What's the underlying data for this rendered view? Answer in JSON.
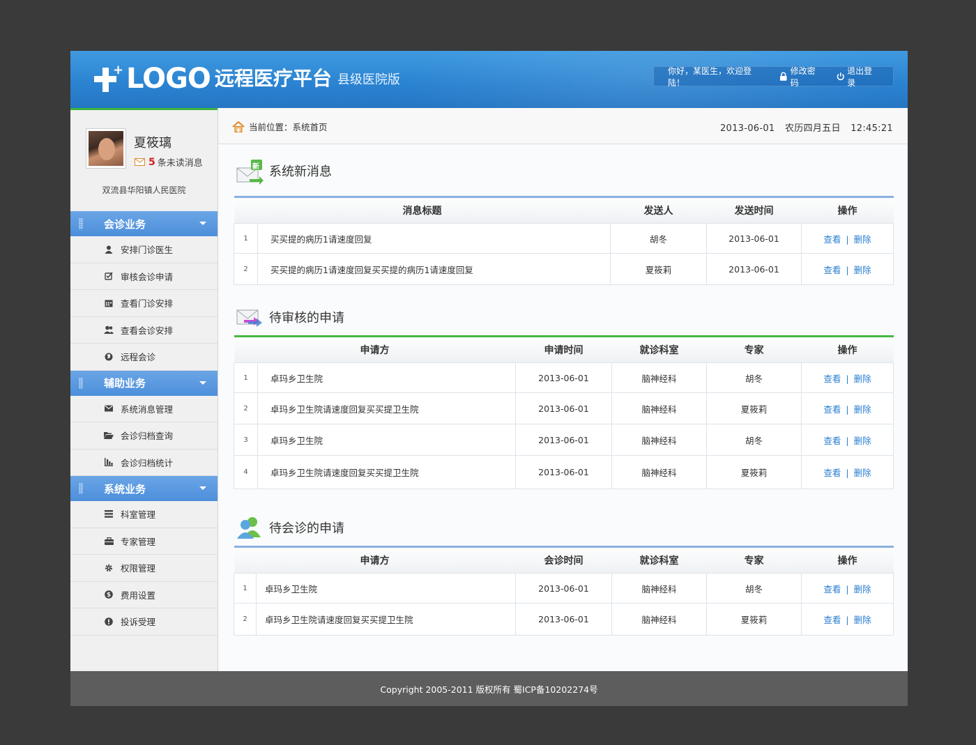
{
  "header": {
    "logo_text": "LOGO",
    "app_name": "远程医疗平台",
    "edition": "县级医院版",
    "greeting": "你好，某医生，欢迎登陆！",
    "change_password": "修改密码",
    "logout": "退出登录"
  },
  "profile": {
    "name": "夏筱璃",
    "unread_count": "5",
    "unread_label": "条未读消息",
    "hospital": "双流县华阳镇人民医院"
  },
  "sidebar": {
    "groups": [
      {
        "title": "会诊业务",
        "items": [
          {
            "label": "安排门诊医生",
            "icon": "user-icon"
          },
          {
            "label": "审核会诊申请",
            "icon": "edit-check-icon"
          },
          {
            "label": "查看门诊安排",
            "icon": "calendar-icon"
          },
          {
            "label": "查看会诊安排",
            "icon": "users-icon"
          },
          {
            "label": "远程会诊",
            "icon": "globe-icon"
          }
        ]
      },
      {
        "title": "辅助业务",
        "items": [
          {
            "label": "系统消息管理",
            "icon": "envelope-icon"
          },
          {
            "label": "会诊归档查询",
            "icon": "folder-open-icon"
          },
          {
            "label": "会诊归档统计",
            "icon": "bar-chart-icon"
          }
        ]
      },
      {
        "title": "系统业务",
        "items": [
          {
            "label": "科室管理",
            "icon": "list-icon"
          },
          {
            "label": "专家管理",
            "icon": "briefcase-icon"
          },
          {
            "label": "权限管理",
            "icon": "gear-icon"
          },
          {
            "label": "费用设置",
            "icon": "dollar-icon"
          },
          {
            "label": "投诉受理",
            "icon": "alert-icon"
          }
        ]
      }
    ]
  },
  "breadcrumb": {
    "label": "当前位置：系统首页"
  },
  "datetime": {
    "date": "2013-06-01",
    "lunar": "农历四月五日",
    "time": "12:45:21"
  },
  "ops": {
    "view": "查看",
    "sep": "|",
    "delete": "删除"
  },
  "messages": {
    "title": "系统新消息",
    "badge": "新",
    "columns": [
      "消息标题",
      "发送人",
      "发送时间",
      "操作"
    ],
    "rows": [
      {
        "idx": "1",
        "title": "买买提的病历1请速度回复",
        "sender": "胡冬",
        "time": "2013-06-01"
      },
      {
        "idx": "2",
        "title": "买买提的病历1请速度回复买买提的病历1请速度回复",
        "sender": "夏筱莉",
        "time": "2013-06-01"
      }
    ]
  },
  "pending_review": {
    "title": "待审核的申请",
    "columns": [
      "申请方",
      "申请时间",
      "就诊科室",
      "专家",
      "操作"
    ],
    "rows": [
      {
        "idx": "1",
        "applicant": "卓玛乡卫生院",
        "time": "2013-06-01",
        "dept": "脑神经科",
        "expert": "胡冬"
      },
      {
        "idx": "2",
        "applicant": "卓玛乡卫生院请速度回复买买提卫生院",
        "time": "2013-06-01",
        "dept": "脑神经科",
        "expert": "夏筱莉"
      },
      {
        "idx": "3",
        "applicant": "卓玛乡卫生院",
        "time": "2013-06-01",
        "dept": "脑神经科",
        "expert": "胡冬"
      },
      {
        "idx": "4",
        "applicant": "卓玛乡卫生院请速度回复买买提卫生院",
        "time": "2013-06-01",
        "dept": "脑神经科",
        "expert": "夏筱莉"
      }
    ]
  },
  "pending_consult": {
    "title": "待会诊的申请",
    "columns": [
      "申请方",
      "会诊时间",
      "就诊科室",
      "专家",
      "操作"
    ],
    "rows": [
      {
        "idx": "1",
        "applicant": "卓玛乡卫生院",
        "time": "2013-06-01",
        "dept": "脑神经科",
        "expert": "胡冬"
      },
      {
        "idx": "2",
        "applicant": "卓玛乡卫生院请速度回复买买提卫生院",
        "time": "2013-06-01",
        "dept": "脑神经科",
        "expert": "夏筱莉"
      }
    ]
  },
  "footer": {
    "copyright": "Copyright 2005-2011 版权所有 蜀ICP备10202274号"
  },
  "colors": {
    "header_blue": "#2a82d0",
    "nav_blue": "#4d8fdb",
    "accent_green": "#46b943",
    "link_blue": "#2a7fd0",
    "footer_gray": "#5d5d5d"
  }
}
